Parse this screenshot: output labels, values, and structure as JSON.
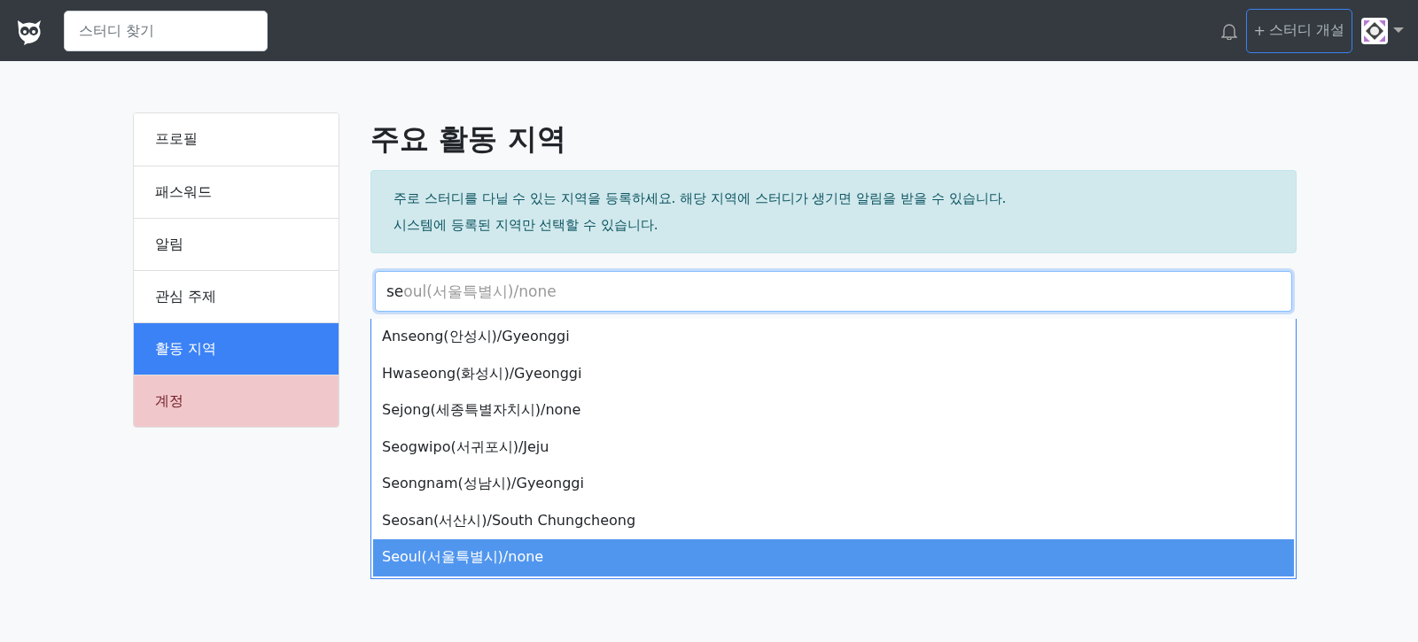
{
  "navbar": {
    "search": {
      "placeholder": "스터디 찾기"
    },
    "create_button": {
      "icon": "+",
      "label": "스터디 개설"
    }
  },
  "sidebar": {
    "items": [
      {
        "label": "프로필",
        "selected": false,
        "kind": "normal"
      },
      {
        "label": "패스워드",
        "selected": false,
        "kind": "normal"
      },
      {
        "label": "알림",
        "selected": false,
        "kind": "normal"
      },
      {
        "label": "관심 주제",
        "selected": false,
        "kind": "normal"
      },
      {
        "label": "활동 지역",
        "selected": true,
        "kind": "normal"
      },
      {
        "label": "계정",
        "selected": false,
        "kind": "danger"
      }
    ]
  },
  "title": "주요 활동 지역",
  "alert": {
    "lines": [
      "주로 스터디를 다닐 수 있는 지역을 등록하세요. 해당 지역에 스터디가 생기면 알림을 받을 수 있습니다.",
      "시스템에 등록된 지역만 선택할 수 있습니다."
    ]
  },
  "zone_input": {
    "value": "se",
    "completion": "oul(서울특별시)/none"
  },
  "suggestions": [
    {
      "label": "Anseong(안성시)/Gyeonggi",
      "selected": false
    },
    {
      "label": "Hwaseong(화성시)/Gyeonggi",
      "selected": false
    },
    {
      "label": "Sejong(세종특별자치시)/none",
      "selected": false
    },
    {
      "label": "Seogwipo(서귀포시)/Jeju",
      "selected": false
    },
    {
      "label": "Seongnam(성남시)/Gyeonggi",
      "selected": false
    },
    {
      "label": "Seosan(서산시)/South Chungcheong",
      "selected": false
    },
    {
      "label": "Seoul(서울특별시)/none",
      "selected": true
    }
  ]
}
